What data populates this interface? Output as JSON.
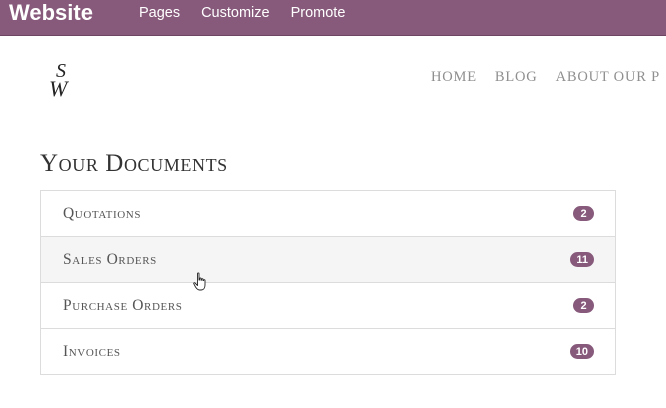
{
  "topbar": {
    "brand": "Website",
    "menu": [
      "Pages",
      "Customize",
      "Promote"
    ]
  },
  "header": {
    "logo_text": "SW",
    "nav": [
      "HOME",
      "BLOG",
      "ABOUT OUR P"
    ]
  },
  "main": {
    "title": "Your Documents",
    "documents": [
      {
        "label": "Quotations",
        "count": "2"
      },
      {
        "label": "Sales Orders",
        "count": "11"
      },
      {
        "label": "Purchase Orders",
        "count": "2"
      },
      {
        "label": "Invoices",
        "count": "10"
      }
    ]
  },
  "colors": {
    "accent": "#875a7b",
    "nav_text": "#8f8f8f",
    "heading_text": "#333333"
  },
  "icons": {
    "cursor": "hand-pointer-icon"
  }
}
